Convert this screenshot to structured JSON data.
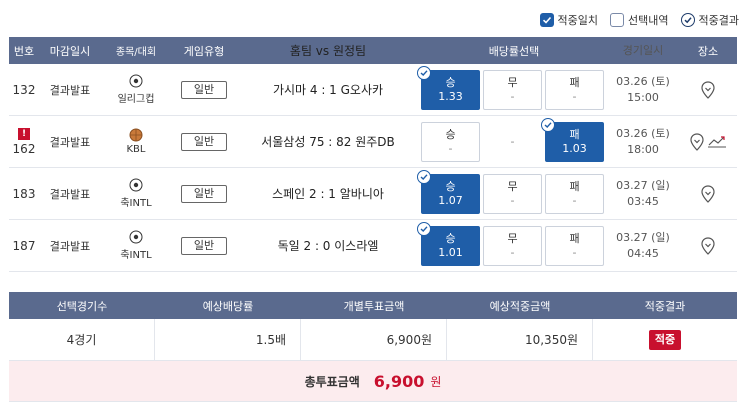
{
  "filters": [
    {
      "label": "적중일치",
      "state": "checked"
    },
    {
      "label": "선택내역",
      "state": "unchecked"
    },
    {
      "label": "적중결과",
      "state": "circle-check"
    }
  ],
  "table": {
    "headers": [
      "번호",
      "마감일시",
      "종목/대회",
      "게임유형",
      "홈팀 vs 원정팀",
      "배당률선택",
      "경기일시",
      "장소"
    ],
    "rows": [
      {
        "num": "132",
        "deadline": "결과발표",
        "league_icon": "soccer-ball-icon",
        "league": "일리그컵",
        "type": "일반",
        "match": "가시마 4 : 1 G오사카",
        "odds": [
          {
            "label": "승",
            "value": "1.33",
            "selected": true
          },
          {
            "label": "무",
            "value": "-"
          },
          {
            "label": "패",
            "value": "-"
          }
        ],
        "date": "03.26 (토)",
        "time": "15:00",
        "alert": false
      },
      {
        "num": "162",
        "deadline": "결과발표",
        "league_icon": "basketball-icon",
        "league": "KBL",
        "type": "일반",
        "match": "서울삼성 75 : 82 원주DB",
        "odds": [
          {
            "label": "승",
            "value": "-"
          },
          {
            "label": "",
            "value": "-",
            "plain": true
          },
          {
            "label": "패",
            "value": "1.03",
            "selected": true
          }
        ],
        "date": "03.26 (토)",
        "time": "18:00",
        "alert": true,
        "alert_mark": "!"
      },
      {
        "num": "183",
        "deadline": "결과발표",
        "league_icon": "soccer-ball-icon",
        "league": "축INTL",
        "type": "일반",
        "match": "스페인 2 : 1 알바니아",
        "odds": [
          {
            "label": "승",
            "value": "1.07",
            "selected": true
          },
          {
            "label": "무",
            "value": "-"
          },
          {
            "label": "패",
            "value": "-"
          }
        ],
        "date": "03.27 (일)",
        "time": "03:45",
        "alert": false
      },
      {
        "num": "187",
        "deadline": "결과발표",
        "league_icon": "soccer-ball-icon",
        "league": "축INTL",
        "type": "일반",
        "match": "독일 2 : 0 이스라엘",
        "odds": [
          {
            "label": "승",
            "value": "1.01",
            "selected": true
          },
          {
            "label": "무",
            "value": "-"
          },
          {
            "label": "패",
            "value": "-"
          }
        ],
        "date": "03.27 (일)",
        "time": "04:45",
        "alert": false
      }
    ]
  },
  "summary": {
    "headers": [
      "선택경기수",
      "예상배당률",
      "개별투표금액",
      "예상적중금액",
      "적중결과"
    ],
    "games": "4경기",
    "odds": "1.5배",
    "bet": "6,900원",
    "expected": "10,350원",
    "result": "적중",
    "total_label": "총투표금액",
    "total_amount": "6,900",
    "total_unit": "원"
  },
  "colors": {
    "header": "#5a6a8e",
    "selected": "#1f5ea8",
    "accent": "#c8102e",
    "total_bg": "#fcecee"
  }
}
